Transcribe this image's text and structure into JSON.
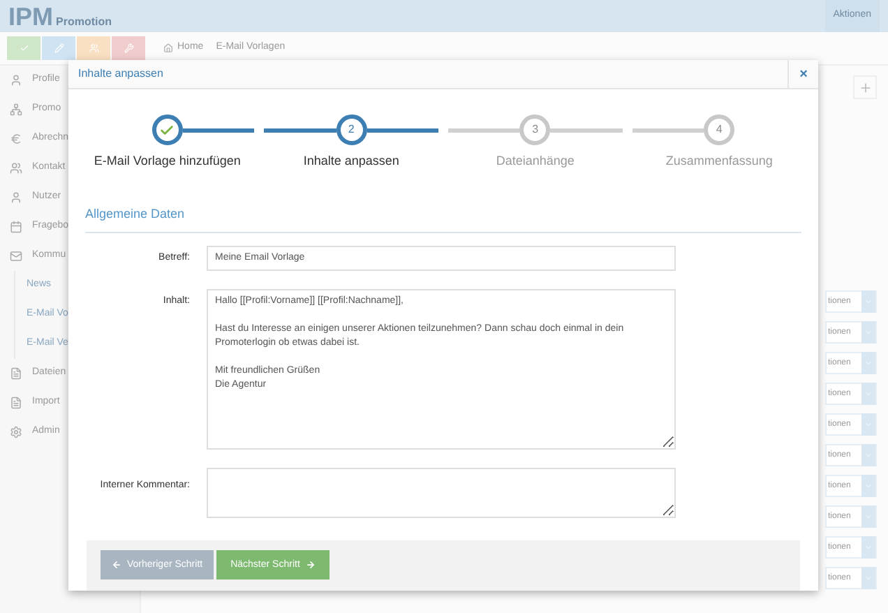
{
  "app": {
    "logo": "IPM",
    "logo_sub": "Promotion",
    "header_action": "Aktionen",
    "breadcrumb": [
      "Home",
      "E-Mail Vorlagen"
    ],
    "sidebar": [
      {
        "label": "Profile",
        "kind": "item"
      },
      {
        "label": "Promo",
        "kind": "item"
      },
      {
        "label": "Abrechn",
        "kind": "item"
      },
      {
        "label": "Kontakt",
        "kind": "item"
      },
      {
        "label": "Nutzer",
        "kind": "item"
      },
      {
        "label": "Fragebo",
        "kind": "item"
      },
      {
        "label": "Kommu",
        "kind": "item"
      },
      {
        "label": "News",
        "kind": "sub"
      },
      {
        "label": "E-Mail Vo",
        "kind": "sub"
      },
      {
        "label": "E-Mail Ve",
        "kind": "sub"
      },
      {
        "label": "Dateien",
        "kind": "item"
      },
      {
        "label": "Import",
        "kind": "item"
      },
      {
        "label": "Admin",
        "kind": "item"
      }
    ],
    "row_actions": [
      "tionen",
      "tionen",
      "tionen",
      "tionen",
      "tionen",
      "tionen",
      "tionen",
      "tionen",
      "tionen",
      "tionen"
    ]
  },
  "modal": {
    "title": "Inhalte anpassen",
    "close": "×",
    "steps": [
      {
        "label": "E-Mail Vorlage hinzufügen",
        "completed": true,
        "selected": false
      },
      {
        "number": "2",
        "label": "Inhalte anpassen",
        "completed": false,
        "selected": true
      },
      {
        "number": "3",
        "label": "Dateianhänge",
        "completed": false,
        "selected": false
      },
      {
        "number": "4",
        "label": "Zusammenfassung",
        "completed": false,
        "selected": false
      }
    ],
    "section_title": "Allgemeine Daten",
    "fields": [
      {
        "label": "Betreff:",
        "kind": "input",
        "value": "Meine Email Vorlage"
      },
      {
        "label": "Inhalt:",
        "kind": "textarea",
        "value": "Hallo [[Profil:Vorname]] [[Profil:Nachname]],\n\nHast du Interesse an einigen unserer Aktionen teilzunehmen? Dann schau doch einmal in dein Promoterlogin ob etwas dabei ist.\n\nMit freundlichen Grüßen\nDie Agentur"
      },
      {
        "label": "Interner Kommentar:",
        "kind": "comment"
      }
    ],
    "buttons": [
      {
        "label": "Vorheriger Schritt",
        "kind": "back"
      },
      {
        "label": "Nächster Schritt",
        "kind": "next"
      }
    ]
  }
}
